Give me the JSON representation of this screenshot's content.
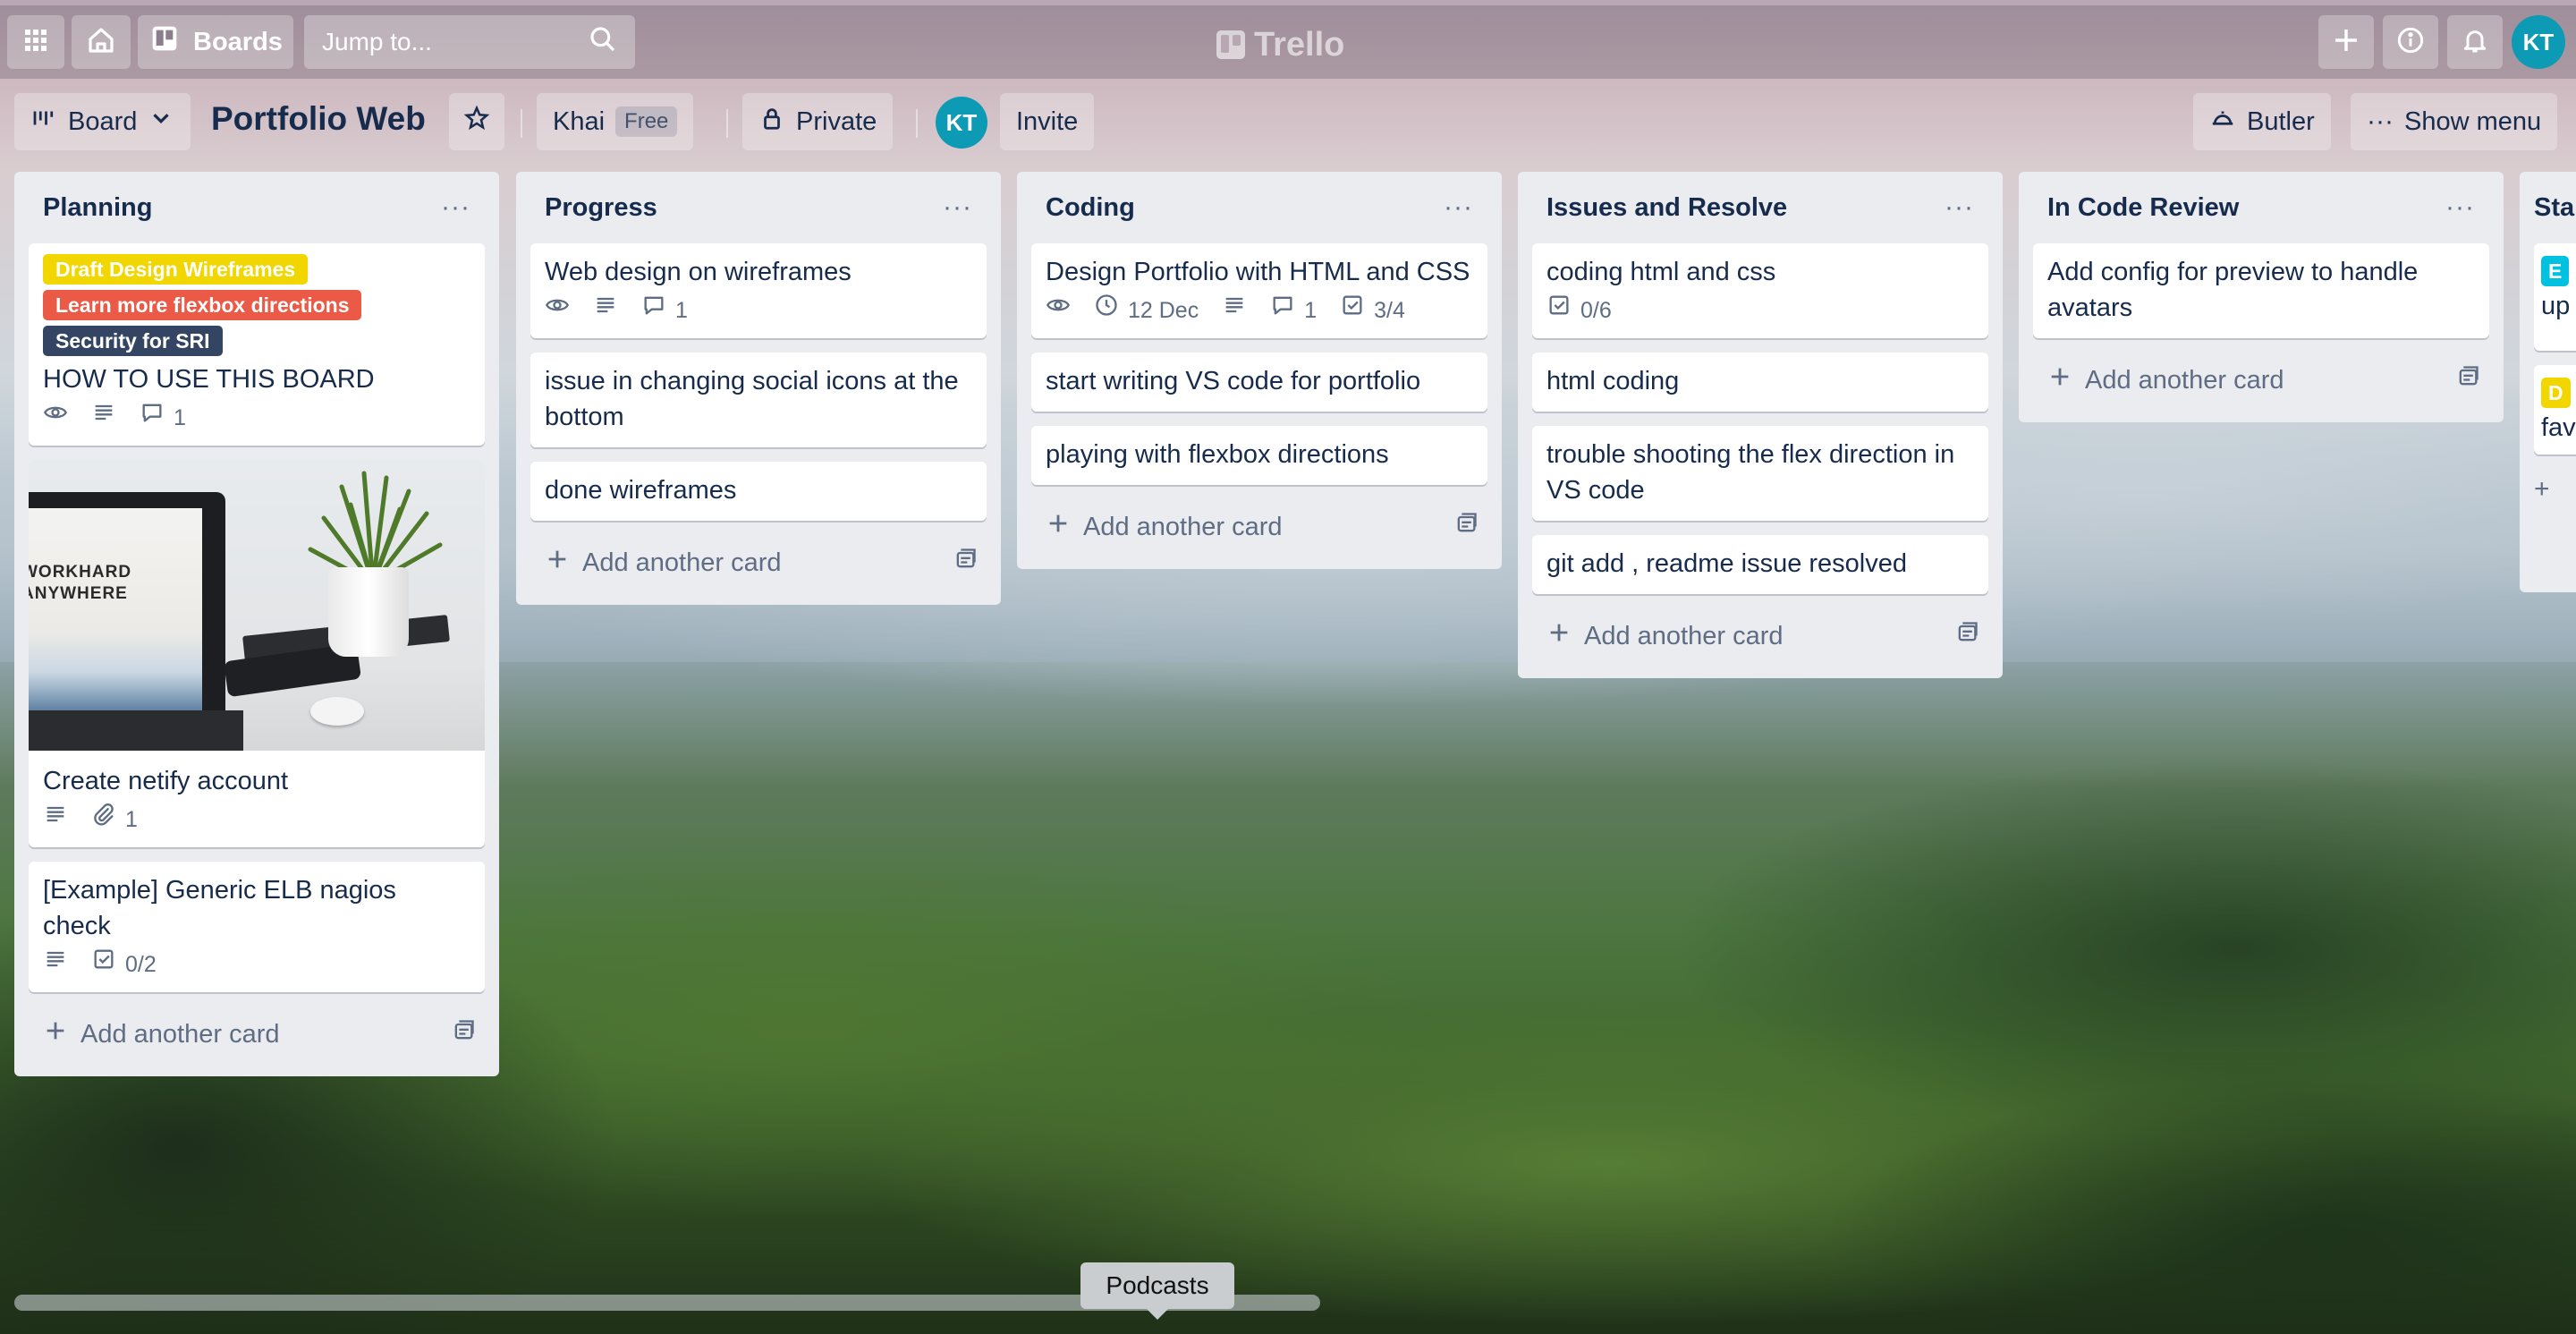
{
  "nav": {
    "boards_label": "Boards",
    "search_placeholder": "Jump to...",
    "logo_text": "Trello",
    "user_initials": "KT"
  },
  "header": {
    "view_label": "Board",
    "title": "Portfolio Web",
    "workspace": "Khai",
    "plan_badge": "Free",
    "visibility": "Private",
    "member_initials": "KT",
    "invite_label": "Invite",
    "butler_label": "Butler",
    "menu_label": "Show menu"
  },
  "add_card_label": "Add another card",
  "lists": [
    {
      "title": "Planning",
      "cards": [
        {
          "labels": [
            {
              "text": "Draft Design Wireframes",
              "color": "#f2d600"
            },
            {
              "text": "Learn more flexbox directions",
              "color": "#eb5a46"
            },
            {
              "text": "Security for SRI",
              "color": "#344563"
            }
          ],
          "title": "HOW TO USE THIS BOARD",
          "comments": "1"
        },
        {
          "cover_text": "WORKHARD ANYWHERE",
          "title": "Create netify account",
          "attachments": "1"
        },
        {
          "title": "[Example] Generic ELB nagios check",
          "checklist": "0/2"
        }
      ]
    },
    {
      "title": "Progress",
      "cards": [
        {
          "title": "Web design on wireframes",
          "comments": "1"
        },
        {
          "title": "issue in changing social icons at the bottom"
        },
        {
          "title": "done wireframes"
        }
      ]
    },
    {
      "title": "Coding",
      "cards": [
        {
          "title": "Design Portfolio with HTML and CSS",
          "due": "12 Dec",
          "comments": "1",
          "checklist": "3/4"
        },
        {
          "title": "start writing VS code for portfolio"
        },
        {
          "title": "playing with flexbox directions"
        }
      ]
    },
    {
      "title": "Issues and Resolve",
      "cards": [
        {
          "title": "coding html and css",
          "checklist": "0/6"
        },
        {
          "title": "html coding"
        },
        {
          "title": "trouble shooting the flex direction in VS code"
        },
        {
          "title": "git add , readme issue resolved"
        }
      ]
    },
    {
      "title": "In Code Review",
      "cards": [
        {
          "title": "Add config for preview to handle avatars"
        }
      ]
    },
    {
      "title": "Sta",
      "cards": [
        {
          "label_fragment": "E",
          "title": "up"
        },
        {
          "label_fragment": "D",
          "title": "fav"
        }
      ]
    }
  ],
  "tooltip": "Podcasts",
  "colors": {
    "label_yellow": "#f2d600",
    "label_red": "#eb5a46",
    "label_navy": "#344563",
    "label_sky": "#00c2e0",
    "avatar": "#0c9ab5"
  }
}
